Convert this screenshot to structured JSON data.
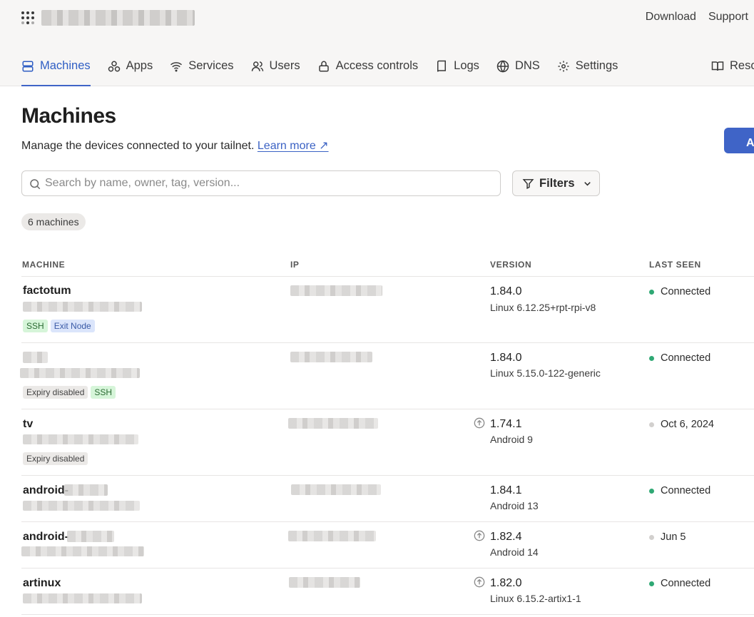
{
  "header": {
    "top_links": [
      "Download",
      "Support"
    ]
  },
  "nav": {
    "items": [
      {
        "label": "Machines",
        "icon": "server-icon",
        "active": true
      },
      {
        "label": "Apps",
        "icon": "apps-icon"
      },
      {
        "label": "Services",
        "icon": "wifi-icon"
      },
      {
        "label": "Users",
        "icon": "users-icon"
      },
      {
        "label": "Access controls",
        "icon": "lock-icon"
      },
      {
        "label": "Logs",
        "icon": "book-icon"
      },
      {
        "label": "DNS",
        "icon": "globe-icon"
      },
      {
        "label": "Settings",
        "icon": "gear-icon"
      }
    ],
    "resources_label": "Reso"
  },
  "page": {
    "title": "Machines",
    "description": "Manage the devices connected to your tailnet.",
    "learn_more": "Learn more ↗",
    "add_button": "Add",
    "search_placeholder": "Search by name, owner, tag, version...",
    "filters_label": "Filters",
    "count_label": "6 machines"
  },
  "table": {
    "columns": [
      "MACHINE",
      "IP",
      "VERSION",
      "LAST SEEN"
    ],
    "rows": [
      {
        "name": "factotum",
        "tags": [
          "SSH",
          "Exit Node"
        ],
        "version": "1.84.0",
        "os": "Linux 6.12.25+rpt-rpi-v8",
        "update_available": false,
        "last_seen": "Connected",
        "connected": true
      },
      {
        "name": "",
        "tags": [
          "Expiry disabled",
          "SSH"
        ],
        "version": "1.84.0",
        "os": "Linux 5.15.0-122-generic",
        "update_available": false,
        "last_seen": "Connected",
        "connected": true
      },
      {
        "name": "tv",
        "tags": [
          "Expiry disabled"
        ],
        "version": "1.74.1",
        "os": "Android 9",
        "update_available": true,
        "last_seen": "Oct 6, 2024",
        "connected": false
      },
      {
        "name": "android-",
        "tags": [],
        "version": "1.84.1",
        "os": "Android 13",
        "update_available": false,
        "last_seen": "Connected",
        "connected": true
      },
      {
        "name": "android-",
        "tags": [],
        "version": "1.82.4",
        "os": "Android 14",
        "update_available": true,
        "last_seen": "Jun 5",
        "connected": false
      },
      {
        "name": "artinux",
        "tags": [],
        "version": "1.82.0",
        "os": "Linux 6.15.2-artix1-1",
        "update_available": true,
        "last_seen": "Connected",
        "connected": true
      }
    ]
  },
  "colors": {
    "accent": "#3f64c7",
    "connected": "#2fa874",
    "offline": "#d2d0ce"
  }
}
